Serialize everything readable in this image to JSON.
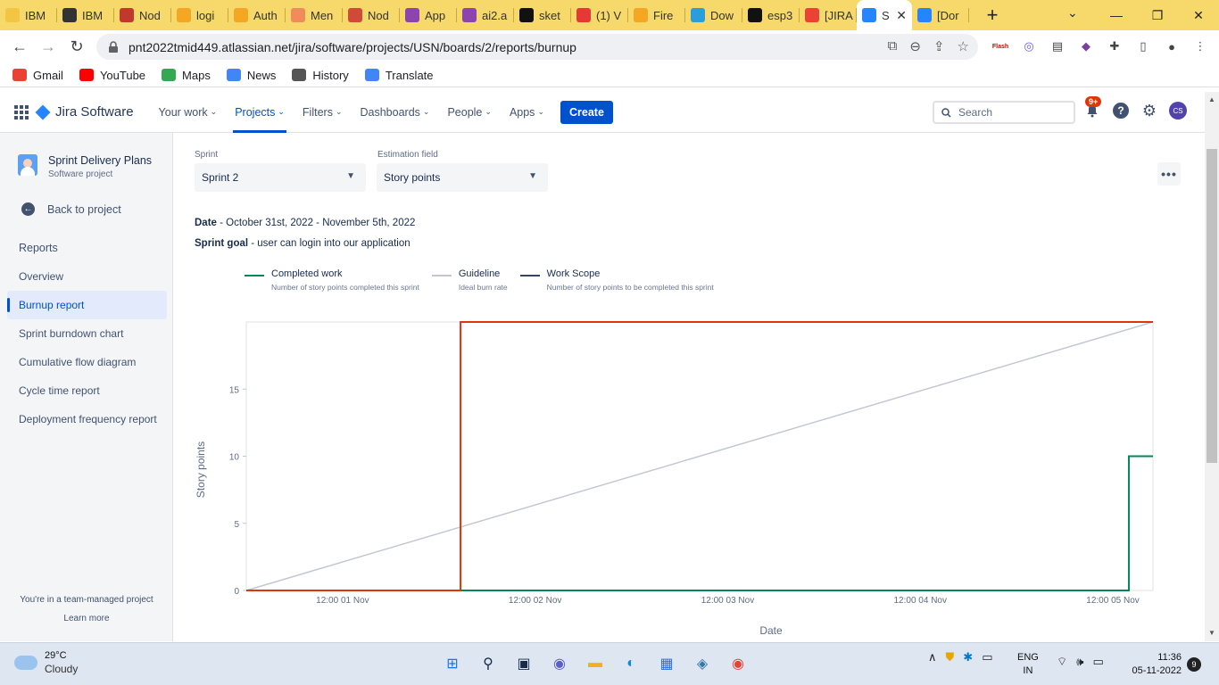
{
  "browser": {
    "tabs": [
      {
        "label": "IBM",
        "color": "#f4c542"
      },
      {
        "label": "IBM",
        "color": "#333333"
      },
      {
        "label": "Nod",
        "color": "#c0392b"
      },
      {
        "label": "logi",
        "color": "#f5a623"
      },
      {
        "label": "Auth",
        "color": "#f5a623"
      },
      {
        "label": "Men",
        "color": "#f08c5a"
      },
      {
        "label": "Nod",
        "color": "#d04a3a"
      },
      {
        "label": "App",
        "color": "#8e44ad"
      },
      {
        "label": "ai2.a",
        "color": "#8e44ad"
      },
      {
        "label": "sket",
        "color": "#111111"
      },
      {
        "label": "(1) V",
        "color": "#e53935"
      },
      {
        "label": "Fire",
        "color": "#f5a623"
      },
      {
        "label": "Dow",
        "color": "#2d9cdb"
      },
      {
        "label": "esp3",
        "color": "#111111"
      },
      {
        "label": "[JIRA",
        "color": "#ea4335"
      },
      {
        "label": "S",
        "color": "#2684ff"
      },
      {
        "label": "[Dor",
        "color": "#2684ff"
      }
    ],
    "url": "pnt2022tmid449.atlassian.net/jira/software/projects/USN/boards/2/reports/burnup",
    "bookmarks": [
      {
        "label": "Gmail",
        "color": "#ea4335"
      },
      {
        "label": "YouTube",
        "color": "#ff0000"
      },
      {
        "label": "Maps",
        "color": "#34a853"
      },
      {
        "label": "News",
        "color": "#4285f4"
      },
      {
        "label": "History",
        "color": "#555555"
      },
      {
        "label": "Translate",
        "color": "#4285f4"
      }
    ]
  },
  "jira": {
    "product": "Jira Software",
    "menu": [
      {
        "label": "Your work",
        "active": false
      },
      {
        "label": "Projects",
        "active": true
      },
      {
        "label": "Filters",
        "active": false
      },
      {
        "label": "Dashboards",
        "active": false
      },
      {
        "label": "People",
        "active": false
      },
      {
        "label": "Apps",
        "active": false
      }
    ],
    "create_label": "Create",
    "search_placeholder": "Search",
    "notification_count": "9+",
    "avatar_initials": "CS"
  },
  "sidebar": {
    "project_name": "Sprint Delivery Plans",
    "project_type": "Software project",
    "back_label": "Back to project",
    "section_title": "Reports",
    "items": [
      {
        "label": "Overview",
        "active": false
      },
      {
        "label": "Burnup report",
        "active": true
      },
      {
        "label": "Sprint burndown chart",
        "active": false
      },
      {
        "label": "Cumulative flow diagram",
        "active": false
      },
      {
        "label": "Cycle time report",
        "active": false
      },
      {
        "label": "Deployment frequency report",
        "active": false
      }
    ],
    "team_note": "You're in a team-managed project",
    "learn_more": "Learn more"
  },
  "report": {
    "sprint_label": "Sprint",
    "sprint_value": "Sprint 2",
    "estimation_label": "Estimation field",
    "estimation_value": "Story points",
    "date_label": "Date",
    "date_value": " - October 31st, 2022 - November 5th, 2022",
    "goal_label": "Sprint goal",
    "goal_value": " - user can login into our application"
  },
  "chart_data": {
    "type": "line",
    "xlabel": "Date",
    "ylabel": "Story points",
    "ylim": [
      0,
      20
    ],
    "yticks": [
      0,
      5,
      10,
      15
    ],
    "x_ticks": [
      "12:00 01 Nov",
      "12:00 02 Nov",
      "12:00 03 Nov",
      "12:00 04 Nov",
      "12:00 05 Nov"
    ],
    "x_domain_hours": [
      0,
      113
    ],
    "legend": [
      {
        "name": "Completed work",
        "description": "Number of story points completed this sprint",
        "color": "#00875a"
      },
      {
        "name": "Guideline",
        "description": "Ideal burn rate",
        "color": "#c1c7d0"
      },
      {
        "name": "Work Scope",
        "description": "Number of story points to be completed this sprint",
        "color": "#344563"
      }
    ],
    "series": [
      {
        "name": "Completed work",
        "color": "#00875a",
        "points": [
          [
            0,
            0
          ],
          [
            110,
            0
          ],
          [
            110,
            10
          ],
          [
            113,
            10
          ]
        ]
      },
      {
        "name": "Guideline",
        "color": "#c1c7d0",
        "points": [
          [
            0,
            0
          ],
          [
            113,
            20
          ]
        ]
      },
      {
        "name": "Work Scope",
        "color": "#de350b",
        "points": [
          [
            0,
            0
          ],
          [
            26.7,
            0
          ],
          [
            26.7,
            20
          ],
          [
            113,
            20
          ]
        ]
      }
    ]
  },
  "taskbar": {
    "temperature": "29°C",
    "weather": "Cloudy",
    "lang1": "ENG",
    "lang2": "IN",
    "time": "11:36",
    "date": "05-11-2022",
    "notifications": "9"
  }
}
